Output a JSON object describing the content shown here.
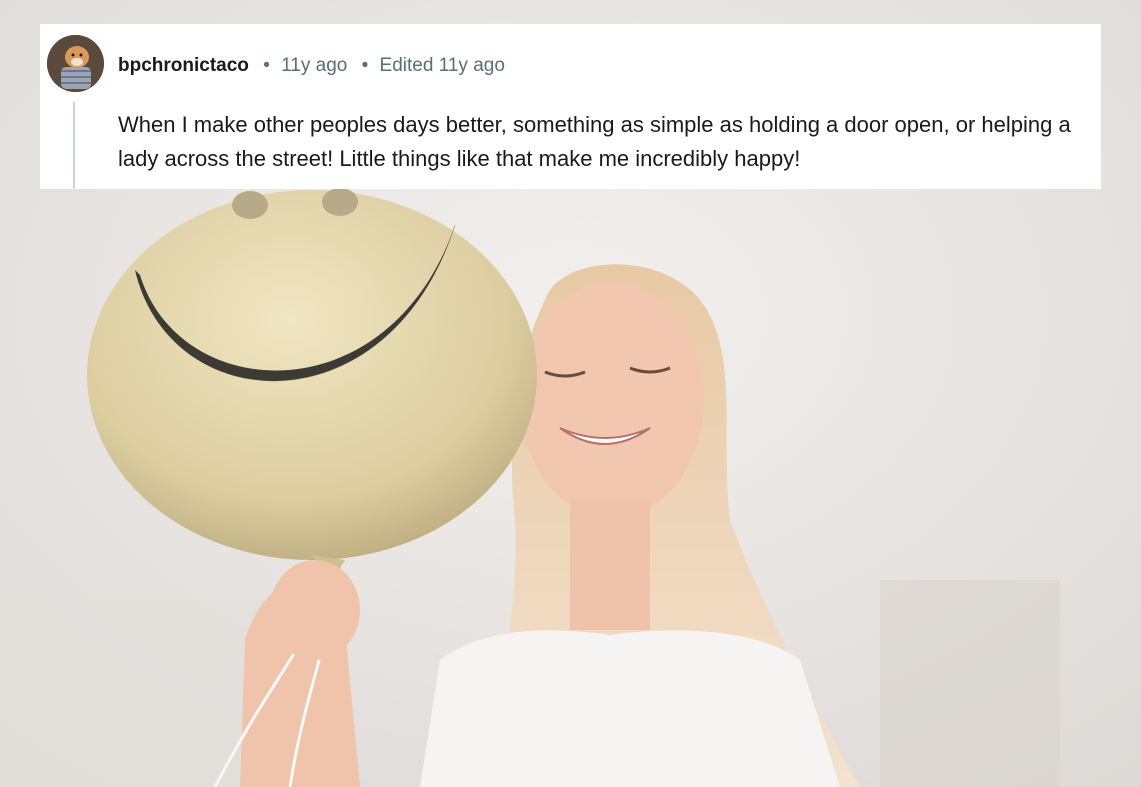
{
  "comment": {
    "username": "bpchronictaco",
    "separator": "•",
    "time": "11y ago",
    "edited": "Edited 11y ago",
    "body": "When I make other peoples days better, something as simple as holding a door open, or helping a lady across the street! Little things like that make me incredibly happy!"
  },
  "colors": {
    "card_bg": "#ffffff",
    "username": "#1a1a1b",
    "meta": "#576f76",
    "thread_line": "#c7d3df",
    "balloon": "#e6d9a8",
    "smile": "#3c3a34"
  }
}
